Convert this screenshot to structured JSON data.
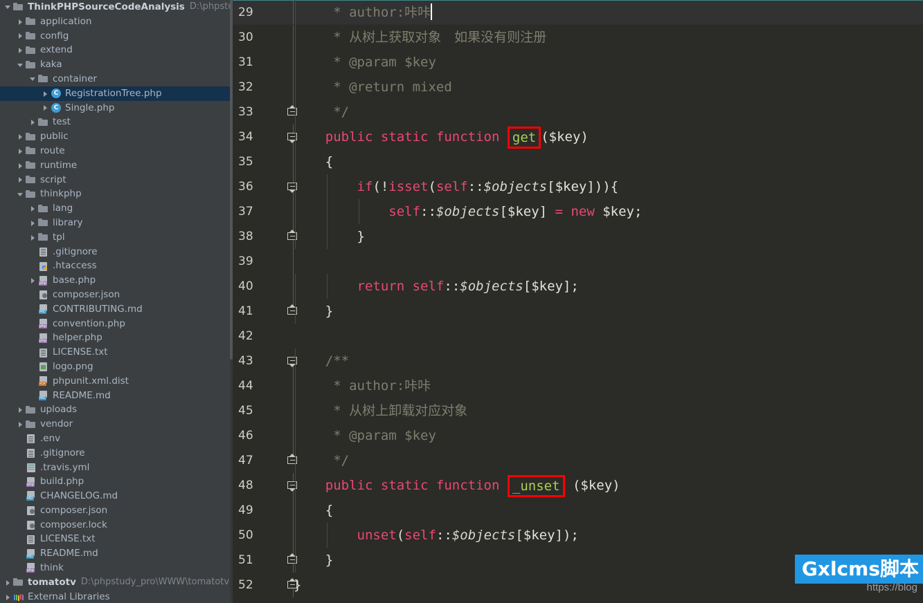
{
  "sidebar": {
    "scrollbar": "vertical-scrollbar",
    "tree": [
      {
        "depth": 0,
        "arrow": "down",
        "icon": "folder-icon",
        "label": "ThinkPHPSourceCodeAnalysis",
        "bold": true,
        "path": "D:\\phpstudy_pro\\W",
        "selected": false
      },
      {
        "depth": 1,
        "arrow": "right",
        "icon": "folder-icon",
        "label": "application",
        "selected": false
      },
      {
        "depth": 1,
        "arrow": "right",
        "icon": "folder-icon",
        "label": "config",
        "selected": false
      },
      {
        "depth": 1,
        "arrow": "right",
        "icon": "folder-icon",
        "label": "extend",
        "selected": false
      },
      {
        "depth": 1,
        "arrow": "down",
        "icon": "folder-icon",
        "label": "kaka",
        "selected": false
      },
      {
        "depth": 2,
        "arrow": "down",
        "icon": "folder-icon",
        "label": "container",
        "selected": false
      },
      {
        "depth": 3,
        "arrow": "right",
        "icon": "php-class-icon",
        "label": "RegistrationTree.php",
        "selected": true
      },
      {
        "depth": 3,
        "arrow": "right",
        "icon": "php-class-icon",
        "label": "Single.php",
        "selected": false
      },
      {
        "depth": 2,
        "arrow": "right",
        "icon": "folder-icon",
        "label": "test",
        "selected": false
      },
      {
        "depth": 1,
        "arrow": "right",
        "icon": "folder-icon",
        "label": "public",
        "selected": false
      },
      {
        "depth": 1,
        "arrow": "right",
        "icon": "folder-icon",
        "label": "route",
        "selected": false
      },
      {
        "depth": 1,
        "arrow": "right",
        "icon": "folder-icon",
        "label": "runtime",
        "selected": false
      },
      {
        "depth": 1,
        "arrow": "right",
        "icon": "folder-icon",
        "label": "script",
        "selected": false
      },
      {
        "depth": 1,
        "arrow": "down",
        "icon": "folder-icon",
        "label": "thinkphp",
        "selected": false
      },
      {
        "depth": 2,
        "arrow": "right",
        "icon": "folder-icon",
        "label": "lang",
        "selected": false
      },
      {
        "depth": 2,
        "arrow": "right",
        "icon": "folder-icon",
        "label": "library",
        "selected": false
      },
      {
        "depth": 2,
        "arrow": "right",
        "icon": "folder-icon",
        "label": "tpl",
        "selected": false
      },
      {
        "depth": 2,
        "arrow": "none",
        "icon": "text-file-icon",
        "label": ".gitignore",
        "selected": false
      },
      {
        "depth": 2,
        "arrow": "none",
        "icon": "htaccess-icon",
        "label": ".htaccess",
        "selected": false
      },
      {
        "depth": 2,
        "arrow": "right",
        "icon": "php-file-icon",
        "label": "base.php",
        "selected": false
      },
      {
        "depth": 2,
        "arrow": "none",
        "icon": "json-file-icon",
        "label": "composer.json",
        "selected": false
      },
      {
        "depth": 2,
        "arrow": "none",
        "icon": "md-file-icon",
        "label": "CONTRIBUTING.md",
        "selected": false
      },
      {
        "depth": 2,
        "arrow": "none",
        "icon": "php-file-icon",
        "label": "convention.php",
        "selected": false
      },
      {
        "depth": 2,
        "arrow": "none",
        "icon": "php-file-icon",
        "label": "helper.php",
        "selected": false
      },
      {
        "depth": 2,
        "arrow": "none",
        "icon": "text-file-icon",
        "label": "LICENSE.txt",
        "selected": false
      },
      {
        "depth": 2,
        "arrow": "none",
        "icon": "image-file-icon",
        "label": "logo.png",
        "selected": false
      },
      {
        "depth": 2,
        "arrow": "none",
        "icon": "xml-file-icon",
        "label": "phpunit.xml.dist",
        "selected": false
      },
      {
        "depth": 2,
        "arrow": "none",
        "icon": "md-file-icon",
        "label": "README.md",
        "selected": false
      },
      {
        "depth": 1,
        "arrow": "right",
        "icon": "folder-icon",
        "label": "uploads",
        "selected": false
      },
      {
        "depth": 1,
        "arrow": "right",
        "icon": "folder-icon",
        "label": "vendor",
        "selected": false
      },
      {
        "depth": 1,
        "arrow": "none",
        "icon": "text-file-icon",
        "label": ".env",
        "selected": false
      },
      {
        "depth": 1,
        "arrow": "none",
        "icon": "text-file-icon",
        "label": ".gitignore",
        "selected": false
      },
      {
        "depth": 1,
        "arrow": "none",
        "icon": "yml-file-icon",
        "label": ".travis.yml",
        "selected": false
      },
      {
        "depth": 1,
        "arrow": "none",
        "icon": "php-file-icon",
        "label": "build.php",
        "selected": false
      },
      {
        "depth": 1,
        "arrow": "none",
        "icon": "md-file-icon",
        "label": "CHANGELOG.md",
        "selected": false
      },
      {
        "depth": 1,
        "arrow": "none",
        "icon": "json-file-icon",
        "label": "composer.json",
        "selected": false
      },
      {
        "depth": 1,
        "arrow": "none",
        "icon": "json-file-icon",
        "label": "composer.lock",
        "selected": false
      },
      {
        "depth": 1,
        "arrow": "none",
        "icon": "text-file-icon",
        "label": "LICENSE.txt",
        "selected": false
      },
      {
        "depth": 1,
        "arrow": "none",
        "icon": "md-file-icon",
        "label": "README.md",
        "selected": false
      },
      {
        "depth": 1,
        "arrow": "none",
        "icon": "php-file-icon",
        "label": "think",
        "selected": false
      },
      {
        "depth": 0,
        "arrow": "right",
        "icon": "folder-icon",
        "label": "tomatotv",
        "bold": true,
        "path": "D:\\phpstudy_pro\\WWW\\tomatotv",
        "selected": false
      },
      {
        "depth": 0,
        "arrow": "right",
        "icon": "external-libraries-icon",
        "label": "External Libraries",
        "selected": false
      }
    ]
  },
  "editor": {
    "current_line": 29,
    "lines": [
      {
        "no": "29",
        "fold": "none",
        "foldline": "full",
        "tokens": [
          {
            "t": "     * author:咔咔",
            "c": "cmt"
          }
        ],
        "caret": true
      },
      {
        "no": "30",
        "fold": "none",
        "foldline": "full",
        "tokens": [
          {
            "t": "     * 从树上获取对象　如果没有则注册",
            "c": "cmt"
          }
        ]
      },
      {
        "no": "31",
        "fold": "none",
        "foldline": "full",
        "tokens": [
          {
            "t": "     * @param $key",
            "c": "cmt"
          }
        ]
      },
      {
        "no": "32",
        "fold": "none",
        "foldline": "full",
        "tokens": [
          {
            "t": "     * @return mixed",
            "c": "cmt"
          }
        ]
      },
      {
        "no": "33",
        "fold": "up",
        "foldline": "half-top",
        "tokens": [
          {
            "t": "     */",
            "c": "cmt"
          }
        ]
      },
      {
        "no": "34",
        "fold": "down",
        "foldline": "full",
        "tokens": [
          {
            "t": "    ",
            "c": "plain"
          },
          {
            "t": "public static function",
            "c": "kw"
          },
          {
            "t": " ",
            "c": "plain"
          },
          {
            "t": "get",
            "c": "fnm",
            "box": true
          },
          {
            "t": "($key)",
            "c": "plain"
          }
        ]
      },
      {
        "no": "35",
        "fold": "none",
        "foldline": "full",
        "tokens": [
          {
            "t": "    {",
            "c": "plain"
          }
        ]
      },
      {
        "no": "36",
        "fold": "down",
        "foldline": "full",
        "tokens": [
          {
            "t": "        ",
            "c": "plain"
          },
          {
            "t": "if",
            "c": "kw"
          },
          {
            "t": "(!",
            "c": "plain"
          },
          {
            "t": "isset",
            "c": "kw"
          },
          {
            "t": "(",
            "c": "plain"
          },
          {
            "t": "self",
            "c": "kw"
          },
          {
            "t": "::",
            "c": "plain"
          },
          {
            "t": "$objects",
            "c": "var"
          },
          {
            "t": "[$key])){",
            "c": "plain"
          }
        ]
      },
      {
        "no": "37",
        "fold": "none",
        "foldline": "full",
        "tokens": [
          {
            "t": "            ",
            "c": "plain"
          },
          {
            "t": "self",
            "c": "kw"
          },
          {
            "t": "::",
            "c": "plain"
          },
          {
            "t": "$objects",
            "c": "var"
          },
          {
            "t": "[$key] ",
            "c": "plain"
          },
          {
            "t": "=",
            "c": "kw"
          },
          {
            "t": " ",
            "c": "plain"
          },
          {
            "t": "new",
            "c": "kw"
          },
          {
            "t": " $key;",
            "c": "plain"
          }
        ]
      },
      {
        "no": "38",
        "fold": "up",
        "foldline": "full",
        "tokens": [
          {
            "t": "        }",
            "c": "plain"
          }
        ]
      },
      {
        "no": "39",
        "fold": "none",
        "foldline": "full",
        "tokens": [
          {
            "t": "",
            "c": "plain"
          }
        ]
      },
      {
        "no": "40",
        "fold": "none",
        "foldline": "full",
        "tokens": [
          {
            "t": "        ",
            "c": "plain"
          },
          {
            "t": "return",
            "c": "kw"
          },
          {
            "t": " ",
            "c": "plain"
          },
          {
            "t": "self",
            "c": "kw"
          },
          {
            "t": "::",
            "c": "plain"
          },
          {
            "t": "$objects",
            "c": "var"
          },
          {
            "t": "[$key];",
            "c": "plain"
          }
        ]
      },
      {
        "no": "41",
        "fold": "up",
        "foldline": "half-top",
        "tokens": [
          {
            "t": "    }",
            "c": "plain"
          }
        ]
      },
      {
        "no": "42",
        "fold": "none",
        "foldline": "none",
        "tokens": [
          {
            "t": "",
            "c": "plain"
          }
        ]
      },
      {
        "no": "43",
        "fold": "down",
        "foldline": "half-bot",
        "tokens": [
          {
            "t": "    /**",
            "c": "cmt"
          }
        ]
      },
      {
        "no": "44",
        "fold": "none",
        "foldline": "full",
        "tokens": [
          {
            "t": "     * author:咔咔",
            "c": "cmt"
          }
        ]
      },
      {
        "no": "45",
        "fold": "none",
        "foldline": "full",
        "tokens": [
          {
            "t": "     * 从树上卸载对应对象",
            "c": "cmt"
          }
        ]
      },
      {
        "no": "46",
        "fold": "none",
        "foldline": "full",
        "tokens": [
          {
            "t": "     * @param $key",
            "c": "cmt"
          }
        ]
      },
      {
        "no": "47",
        "fold": "up",
        "foldline": "half-top",
        "tokens": [
          {
            "t": "     */",
            "c": "cmt"
          }
        ]
      },
      {
        "no": "48",
        "fold": "down",
        "foldline": "full",
        "tokens": [
          {
            "t": "    ",
            "c": "plain"
          },
          {
            "t": "public static function",
            "c": "kw"
          },
          {
            "t": " ",
            "c": "plain"
          },
          {
            "t": "_unset",
            "c": "fnm",
            "box": true
          },
          {
            "t": " ($key)",
            "c": "plain"
          }
        ]
      },
      {
        "no": "49",
        "fold": "none",
        "foldline": "full",
        "tokens": [
          {
            "t": "    {",
            "c": "plain"
          }
        ]
      },
      {
        "no": "50",
        "fold": "none",
        "foldline": "full",
        "tokens": [
          {
            "t": "        ",
            "c": "plain"
          },
          {
            "t": "unset",
            "c": "kw"
          },
          {
            "t": "(",
            "c": "plain"
          },
          {
            "t": "self",
            "c": "kw"
          },
          {
            "t": "::",
            "c": "plain"
          },
          {
            "t": "$objects",
            "c": "var"
          },
          {
            "t": "[$key]);",
            "c": "plain"
          }
        ]
      },
      {
        "no": "51",
        "fold": "up",
        "foldline": "full",
        "tokens": [
          {
            "t": "    }",
            "c": "plain"
          }
        ]
      },
      {
        "no": "52",
        "fold": "up",
        "foldline": "half-bot",
        "tokens": [
          {
            "t": "}",
            "c": "plain"
          }
        ]
      }
    ]
  },
  "watermark": {
    "url": "https://blog",
    "badge": "Gxlcms脚本"
  },
  "colors": {
    "sidebar_bg": "#3c3f41",
    "editor_bg": "#2b2b28",
    "selection_bg": "#14314d",
    "keyword": "#e84a6f",
    "comment": "#7e7e6e",
    "function_name": "#a9d155",
    "annotation_box": "#ff0000",
    "watermark_badge_bg": "#2196e3",
    "caret_line_border": "#3d8a8a"
  }
}
